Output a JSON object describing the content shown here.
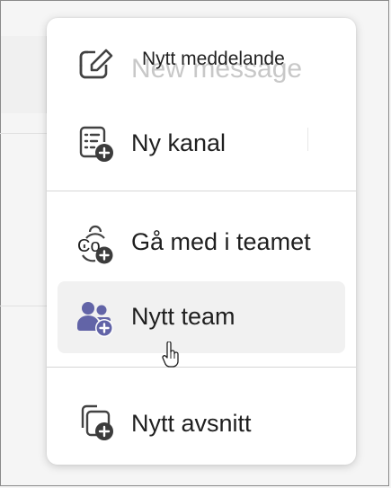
{
  "menu": {
    "ghost_text": "New message",
    "items": [
      {
        "label": "Nytt meddelande",
        "icon": "compose-icon"
      },
      {
        "label": "Ny kanal",
        "icon": "add-channel-icon"
      },
      {
        "label": "Gå med i teamet",
        "icon": "join-team-icon"
      },
      {
        "label": "Nytt team",
        "icon": "add-team-icon"
      },
      {
        "label": "Nytt avsnitt",
        "icon": "add-section-icon"
      }
    ],
    "highlighted_item": "Nytt team"
  },
  "colors": {
    "icon": "#424242",
    "accent": "#6264a7",
    "badge": "#3c3c3c"
  }
}
